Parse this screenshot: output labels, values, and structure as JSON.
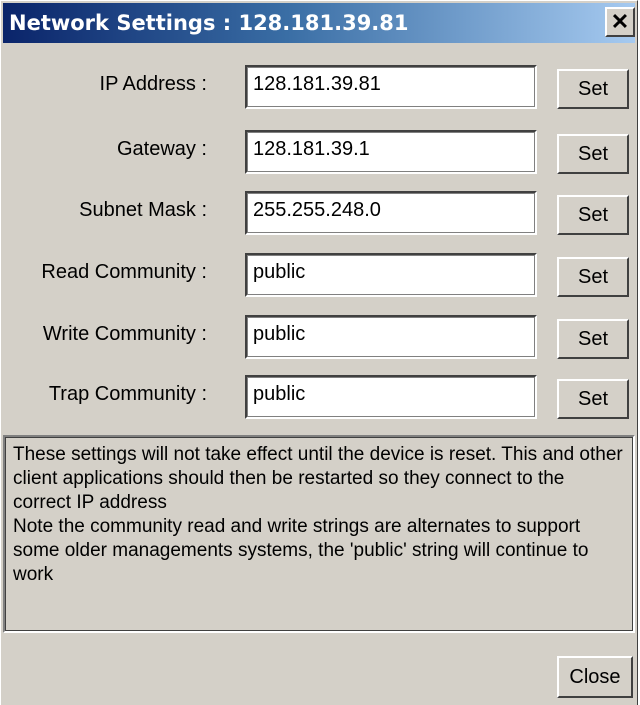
{
  "window": {
    "title": "Network Settings : 128.181.39.81",
    "close_glyph": "✕"
  },
  "fields": [
    {
      "label": "IP Address :",
      "value": "128.181.39.81",
      "button": "Set"
    },
    {
      "label": "Gateway :",
      "value": "128.181.39.1",
      "button": "Set"
    },
    {
      "label": "Subnet Mask :",
      "value": "255.255.248.0",
      "button": "Set"
    },
    {
      "label": "Read Community :",
      "value": "public",
      "button": "Set"
    },
    {
      "label": "Write Community :",
      "value": "public",
      "button": "Set"
    },
    {
      "label": "Trap Community :",
      "value": "public",
      "button": "Set"
    }
  ],
  "notes": "These settings will not take effect until the device is reset. This and other client applications should then be restarted so they connect to the correct IP address\nNote the community read and write strings are alternates to support some older managements systems, the 'public' string will continue to work",
  "footer": {
    "close_label": "Close"
  },
  "colors": {
    "title_gradient_start": "#0a246a",
    "title_gradient_end": "#a6caf0",
    "dialog_face": "#d4d0c8"
  }
}
